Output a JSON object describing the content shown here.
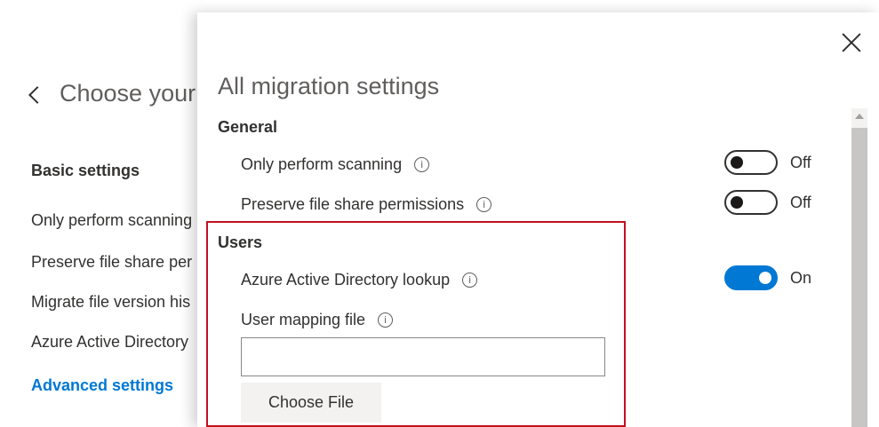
{
  "back": {
    "title": "Choose your",
    "heading": "Basic settings",
    "items": [
      {
        "label": "Only perform scanning"
      },
      {
        "label": "Preserve file share per"
      },
      {
        "label": "Migrate file version his"
      },
      {
        "label": "Azure Active Directory"
      }
    ],
    "advanced": "Advanced settings"
  },
  "panel": {
    "title": "All migration settings",
    "general": {
      "heading": "General",
      "rows": [
        {
          "label": "Only perform scanning",
          "state": "Off"
        },
        {
          "label": "Preserve file share permissions",
          "state": "Off"
        }
      ]
    },
    "users": {
      "heading": "Users",
      "aad_label": "Azure Active Directory lookup",
      "aad_state": "On",
      "mapping_label": "User mapping file",
      "file_value": "",
      "choose_label": "Choose File"
    },
    "info_glyph": "i"
  },
  "colors": {
    "accent": "#0078d4",
    "highlight": "#c50f1f"
  }
}
